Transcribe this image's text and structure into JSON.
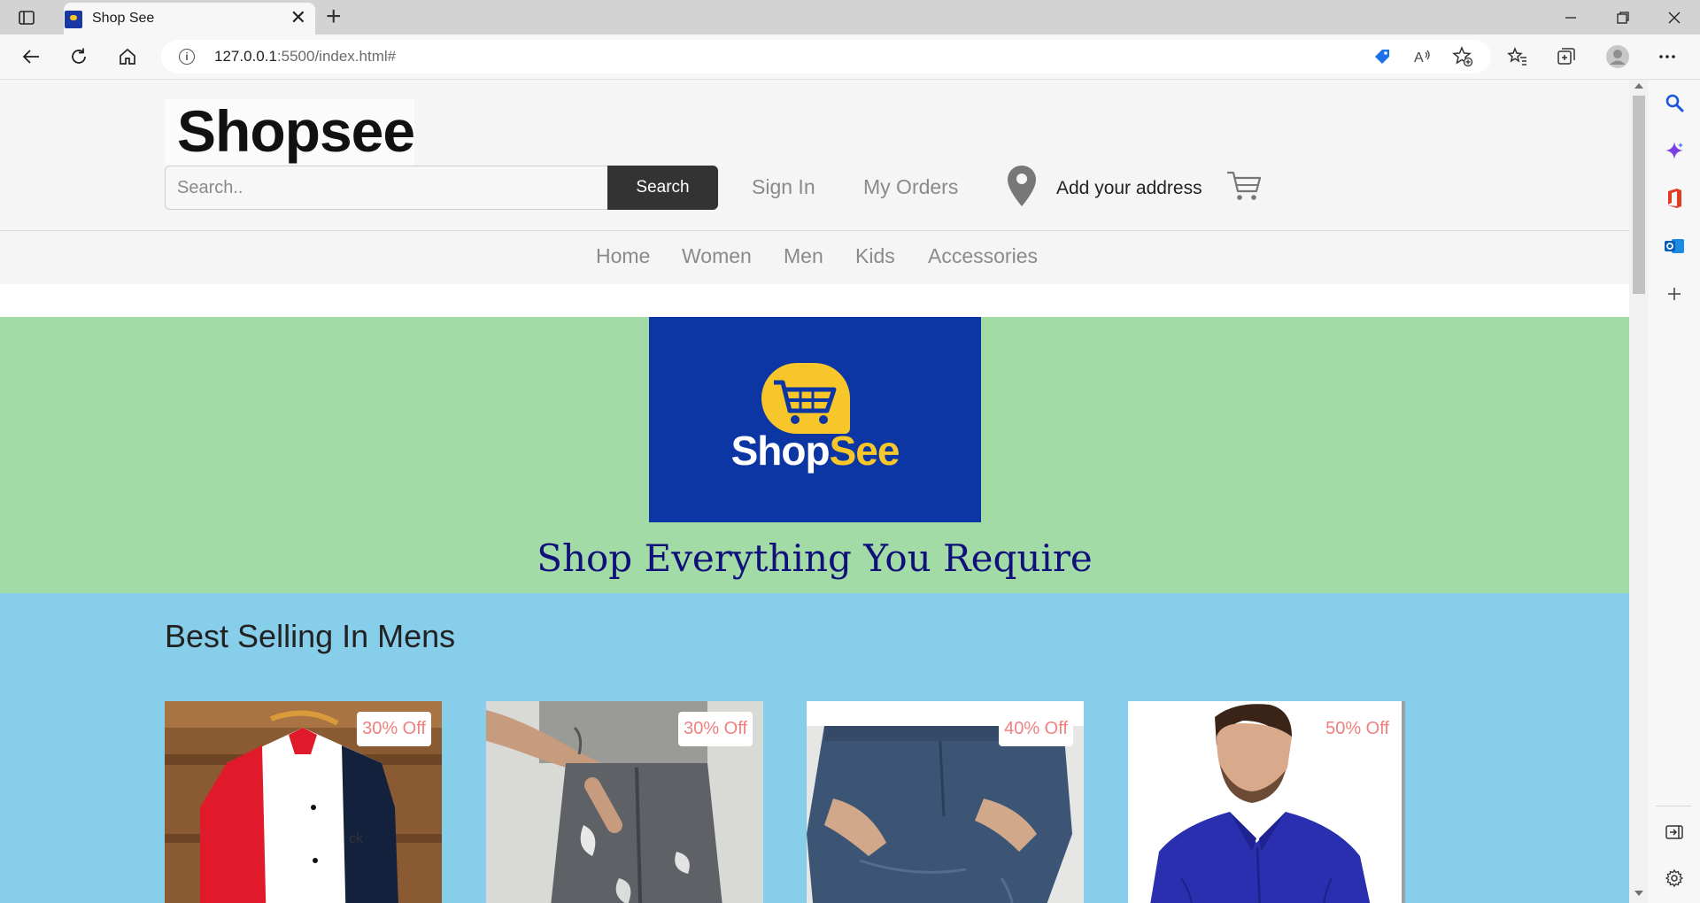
{
  "browser": {
    "tab_title": "Shop See",
    "url_host": "127.0.0.1",
    "url_rest": ":5500/index.html#"
  },
  "header": {
    "logo_text": "Shopsee",
    "search_placeholder": "Search..",
    "search_button": "Search",
    "sign_in": "Sign In",
    "my_orders": "My Orders",
    "address": "Add your address"
  },
  "categories": [
    "Home",
    "Women",
    "Men",
    "Kids",
    "Accessories"
  ],
  "hero": {
    "brand_part1": "Shop",
    "brand_part2": "See",
    "tagline": "Shop Everything You Require"
  },
  "best_selling": {
    "title": "Best Selling In Mens",
    "products": [
      {
        "discount": "30% Off",
        "image": "striped-shirt"
      },
      {
        "discount": "30% Off",
        "image": "grey-ripped-jeans"
      },
      {
        "discount": "40% Off",
        "image": "blue-denim-jeans"
      },
      {
        "discount": "50% Off",
        "image": "blue-silk-shirt"
      }
    ]
  },
  "colors": {
    "hero_bg": "#a2dba6",
    "best_bg": "#87ceeb",
    "brand_blue": "#0c36a3",
    "brand_yellow": "#f7c62a",
    "discount_text": "#f08080"
  }
}
